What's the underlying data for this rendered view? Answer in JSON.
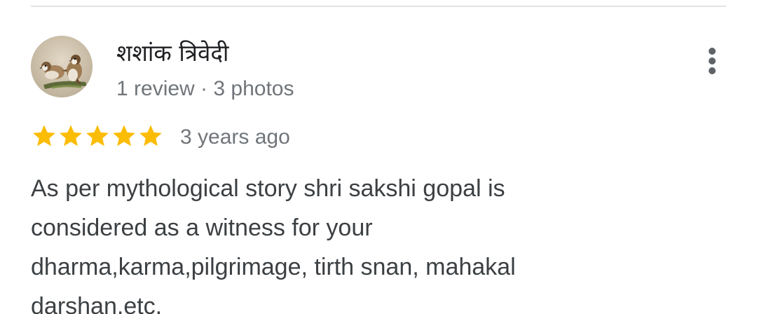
{
  "review": {
    "author": {
      "name": "शशांक त्रिवेदी",
      "meta": "1 review · 3 photos",
      "avatar_icon": "sparrow-photo-avatar"
    },
    "more_icon": "more-vertical-icon",
    "rating": {
      "stars": 5,
      "max": 5,
      "color": "#fbbc04"
    },
    "time_ago": "3 years ago",
    "text_lines": [
      "As per mythological story shri sakshi gopal is",
      "considered as a witness for your",
      "dharma,karma,pilgrimage, tirth snan, mahakal",
      "darshan,etc."
    ]
  },
  "colors": {
    "divider": "#e3e3e3",
    "name": "#202124",
    "secondary": "#70757a",
    "body": "#3c4043",
    "star": "#fbbc04"
  }
}
